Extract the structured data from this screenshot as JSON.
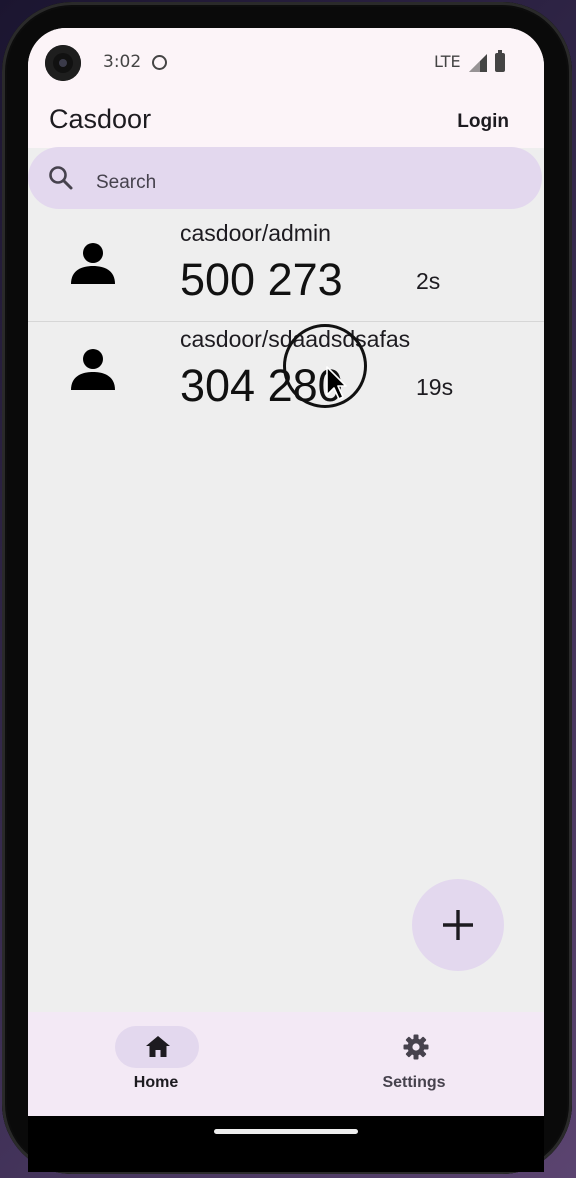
{
  "status_bar": {
    "time": "3:02",
    "network": "LTE"
  },
  "app_bar": {
    "title": "Casdoor",
    "login_label": "Login"
  },
  "search": {
    "placeholder": "Search"
  },
  "accounts": [
    {
      "name": "casdoor/admin",
      "code": "500 273",
      "remaining": "2s"
    },
    {
      "name": "casdoor/sdaadsdsafas",
      "code": "304 280",
      "remaining": "19s"
    }
  ],
  "fab": {
    "icon": "plus-icon"
  },
  "bottom_nav": {
    "items": [
      {
        "label": "Home",
        "icon": "home-icon",
        "selected": true
      },
      {
        "label": "Settings",
        "icon": "gear-icon",
        "selected": false
      }
    ]
  },
  "colors": {
    "surface": "#eeeeee",
    "top_bar": "#fcf4f8",
    "accent_container": "#e3d8ee",
    "nav_bar": "#f3e9f5"
  }
}
